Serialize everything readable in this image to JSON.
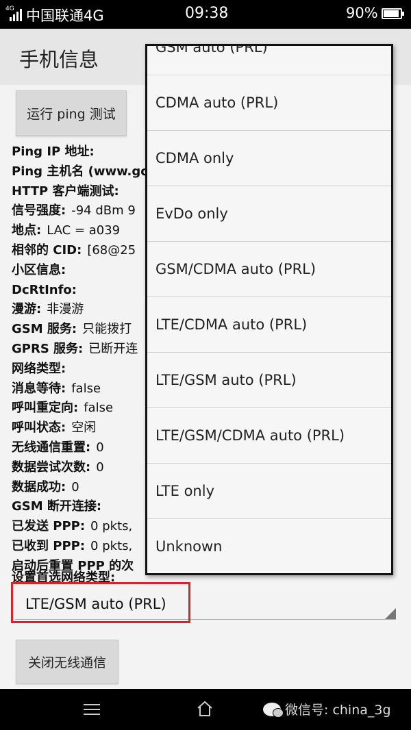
{
  "status_bar": {
    "network_tag": "4G",
    "carrier": "中国联通4G",
    "time": "09:38",
    "battery_percent": "90%",
    "battery_level": 0.9
  },
  "title_bar": {
    "title": "手机信息"
  },
  "ping_button_label": "运行 ping 测试",
  "info_rows": [
    {
      "label": "Ping IP 地址:",
      "value": ""
    },
    {
      "label": "Ping 主机名 (www.go",
      "value": ""
    },
    {
      "label": "HTTP 客户端测试:",
      "value": ""
    },
    {
      "label": "信号强度:",
      "value": "-94 dBm  9"
    },
    {
      "label": "地点:",
      "value": "LAC = a039"
    },
    {
      "label": "相邻的 CID:",
      "value": "[68@25"
    },
    {
      "label": "小区信息:",
      "value": ""
    },
    {
      "label": "DcRtInfo:",
      "value": ""
    },
    {
      "label": "漫游:",
      "value": "非漫游"
    },
    {
      "label": "GSM 服务:",
      "value": "只能拨打"
    },
    {
      "label": "GPRS 服务:",
      "value": "已断开连"
    },
    {
      "label": "网络类型:",
      "value": ""
    },
    {
      "label": "消息等待:",
      "value": "false"
    },
    {
      "label": "呼叫重定向:",
      "value": "false"
    },
    {
      "label": "呼叫状态:",
      "value": "空闲"
    },
    {
      "label": "无线通信重置:",
      "value": "0"
    },
    {
      "label": "数据尝试次数:",
      "value": "0"
    },
    {
      "label": "数据成功:",
      "value": "0"
    },
    {
      "label": "GSM 断开连接:",
      "value": ""
    },
    {
      "label": "已发送 PPP:",
      "value": "0 pkts,"
    },
    {
      "label": "已收到 PPP:",
      "value": "0 pkts,"
    },
    {
      "label": "启动后重置 PPP 的次",
      "value": ""
    }
  ],
  "preferred_network_label": "设置首选网络类型:",
  "preferred_network_selected": "LTE/GSM auto (PRL)",
  "dropdown_options": [
    "GSM auto (PRL)",
    "CDMA auto (PRL)",
    "CDMA only",
    "EvDo only",
    "GSM/CDMA auto (PRL)",
    "LTE/CDMA auto (PRL)",
    "LTE/GSM auto (PRL)",
    "LTE/GSM/CDMA auto (PRL)",
    "LTE only",
    "Unknown"
  ],
  "radio_button_label": "关闭无线通信",
  "nav_bar": {
    "watermark_text": "微信号: china_3g"
  },
  "colors": {
    "highlight": "#d8232a",
    "status_bar_bg": "#000000"
  }
}
